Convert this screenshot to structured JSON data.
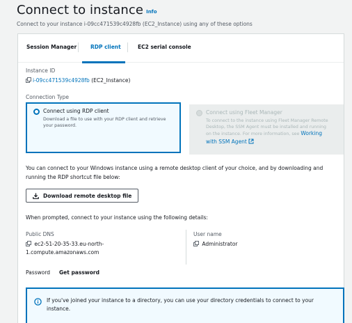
{
  "header": {
    "title": "Connect to instance",
    "info": "Info",
    "subtitle": "Connect to your instance i-09cc471539c4928fb (EC2_Instance) using any of these options"
  },
  "tabs": [
    {
      "label": "Session Manager"
    },
    {
      "label": "RDP client"
    },
    {
      "label": "EC2 serial console"
    }
  ],
  "instance": {
    "label": "Instance ID",
    "id": "i-09cc471539c4928fb",
    "name": "(EC2_Instance)"
  },
  "connection_type": {
    "label": "Connection Type",
    "rdp_title": "Connect using RDP client",
    "rdp_desc_1": "Download a file to use with your RDP client and retrieve",
    "rdp_desc_2": "your password.",
    "fleet_title": "Connect using Fleet Manager",
    "fleet_desc_1": "To connect to the instance using Fleet Manager Remote",
    "fleet_desc_2": "Desktop, the SSM Agent must be installed and running",
    "fleet_desc_3": "on the instance. For more information, see",
    "fleet_link_1": "Working",
    "fleet_link_2": "with SSM Agent"
  },
  "rdp_intro_1": "You can connect to your Windows instance using a remote desktop client of your choice, and by downloading and",
  "rdp_intro_2": "running the RDP shortcut file below:",
  "download_button": "Download remote desktop file",
  "prompt_text": "When prompted, connect to your instance using the following details:",
  "public_dns": {
    "label": "Public DNS",
    "value_1": "ec2-51-20-35-33.eu-north-",
    "value_2": "1.compute.amazonaws.com"
  },
  "user_name": {
    "label": "User name",
    "value": "Administrator"
  },
  "password": {
    "label": "Password",
    "action": "Get password"
  },
  "alert": {
    "line_1": "If you've joined your instance to a directory, you can use your directory credentials to connect to your",
    "line_2": "instance."
  },
  "colors": {
    "accent": "#0073bb",
    "selected_bg": "#f1faff",
    "disabled_bg": "#eaeded"
  }
}
